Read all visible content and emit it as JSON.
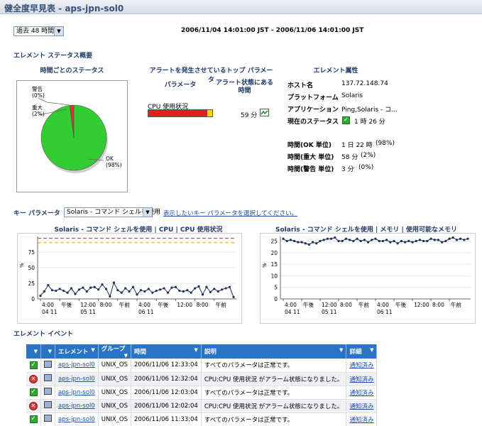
{
  "title": "健全度早見表 - aps-jpn-sol0",
  "time_range": {
    "select": "過去 48 時間",
    "span": "2006/11/04 14:01:00 JST - 2006/11/06 14:01:00 JST"
  },
  "element_status": {
    "heading": "エレメント ステータス概要",
    "hourly": {
      "heading": "時間ごとのステータス",
      "labels": {
        "warning": "警告",
        "warning_pct": "(0%)",
        "critical": "重大",
        "critical_pct": "(2%)",
        "ok": "OK",
        "ok_pct": "(98%)"
      },
      "slices": [
        {
          "name": "OK",
          "value": 98,
          "color": "#33cc33"
        },
        {
          "name": "重大",
          "value": 2,
          "color": "#e03030"
        },
        {
          "name": "警告",
          "value": 0,
          "color": "#ffd700"
        }
      ]
    },
    "top_params": {
      "heading": "アラートを発生させているトップ パラメータ",
      "col_param": "パラメータ",
      "col_alarm": "アラート状態にある時間",
      "rows": [
        {
          "name": "CPU 使用状況",
          "time": "59 分",
          "red_frac": 0.92
        }
      ]
    },
    "attributes": {
      "heading": "エレメント属性",
      "rows": [
        {
          "label": "ホスト名",
          "value": "137.72.148.74"
        },
        {
          "label": "プラットフォーム",
          "value": "Solaris"
        },
        {
          "label": "アプリケーション",
          "value": "Ping,Solaris - コ..."
        },
        {
          "label": "現在のステータス",
          "value": "1 時 26 分"
        }
      ],
      "durations": [
        {
          "label": "時間(OK 単位)",
          "value": "1 日 22 時",
          "pct": "(98%)"
        },
        {
          "label": "時間(重大 単位)",
          "value": "58 分",
          "pct": "(2%)"
        },
        {
          "label": "時間(警告 単位)",
          "value": "3 分",
          "pct": "(0%)"
        }
      ]
    }
  },
  "key_params": {
    "label": "キー パラメータ",
    "select": "Solaris - コマンド シェルを使用",
    "link": "表示したいキー パラメータを選択してください。"
  },
  "chart_data": [
    {
      "type": "line",
      "title": "Solaris - コマンド シェルを使用 | CPU | CPU 使用状況",
      "ylabel": "%",
      "ylim": [
        0,
        100
      ],
      "yticks": [
        "0",
        "25",
        "50",
        "75"
      ],
      "thresholds": [
        {
          "value": 97,
          "color": "#e05050"
        },
        {
          "value": 90,
          "color": "#f0b000"
        }
      ],
      "xticks": [
        {
          "top": "4:00",
          "bottom": "04 11"
        },
        {
          "top": "午後",
          "bottom": ""
        },
        {
          "top": "12:00",
          "bottom": "05 11"
        },
        {
          "top": "8:00",
          "bottom": ""
        },
        {
          "top": "午前",
          "bottom": ""
        },
        {
          "top": "4:00",
          "bottom": "06 11"
        },
        {
          "top": "午後",
          "bottom": ""
        },
        {
          "top": "12:00",
          "bottom": ""
        },
        {
          "top": "8:00",
          "bottom": ""
        },
        {
          "top": "午前",
          "bottom": ""
        }
      ],
      "values": [
        5,
        12,
        22,
        14,
        13,
        16,
        13,
        10,
        17,
        8,
        15,
        18,
        12,
        18,
        19,
        15,
        23,
        16,
        4,
        26,
        14,
        10,
        17,
        12,
        19,
        7,
        14,
        12,
        16,
        10,
        13,
        15,
        17,
        10,
        18,
        19,
        13,
        12,
        14,
        10,
        17,
        20,
        7,
        19,
        11,
        16,
        12,
        15,
        17,
        19,
        3
      ]
    },
    {
      "type": "line",
      "title": "Solaris - コマンド シェルを使用 | メモリ | 使用可能なメモリ",
      "ylabel": "%",
      "ylim": [
        0,
        27
      ],
      "yticks": [
        "0",
        "5",
        "10",
        "15",
        "20",
        "25"
      ],
      "xticks": [
        {
          "top": "4:00",
          "bottom": "04 11"
        },
        {
          "top": "午後",
          "bottom": ""
        },
        {
          "top": "12:00",
          "bottom": "05 11"
        },
        {
          "top": "8:00",
          "bottom": ""
        },
        {
          "top": "午前",
          "bottom": ""
        },
        {
          "top": "4:00",
          "bottom": "06 11"
        },
        {
          "top": "午後",
          "bottom": ""
        },
        {
          "top": "12:00",
          "bottom": ""
        },
        {
          "top": "8:00",
          "bottom": ""
        },
        {
          "top": "午前",
          "bottom": ""
        }
      ],
      "values": [
        26,
        25,
        25.5,
        25,
        24.5,
        24.5,
        24,
        23.5,
        24.5,
        24,
        25,
        25.5,
        26,
        26,
        26.5,
        25,
        25,
        26,
        25.5,
        25,
        26,
        25,
        25.5,
        24.5,
        25.5,
        26,
        25,
        25,
        25.5,
        24.5,
        25,
        24,
        25,
        24.5,
        25,
        24.5,
        25,
        25.5,
        25,
        25,
        26,
        25.5,
        25.5,
        24.5,
        25,
        26,
        26.5,
        25.5,
        26,
        25.5,
        26
      ]
    }
  ],
  "events": {
    "heading": "エレメント イベント",
    "columns": [
      "",
      "",
      "エレメント",
      "グループ",
      "時間",
      "説明",
      "詳細"
    ],
    "rows": [
      {
        "status": "ok",
        "element": "aps-jpn-sol0",
        "group": "UNIX_OS",
        "time": "2006/11/06 12:33:04",
        "desc": "すべてのパラメータは正常です。",
        "detail": "通知済み"
      },
      {
        "status": "critical",
        "element": "aps-jpn-sol0",
        "group": "UNIX_OS",
        "time": "2006/11/06 12:32:04",
        "desc": "CPU:CPU 使用状況 がアラーム状態になりました。",
        "detail": "通知済み"
      },
      {
        "status": "ok",
        "element": "aps-jpn-sol0",
        "group": "UNIX_OS",
        "time": "2006/11/06 12:03:04",
        "desc": "すべてのパラメータは正常です。",
        "detail": "通知済み"
      },
      {
        "status": "critical",
        "element": "aps-jpn-sol0",
        "group": "UNIX_OS",
        "time": "2006/11/06 12:02:04",
        "desc": "CPU:CPU 使用状況 がアラーム状態になりました。",
        "detail": "通知済み"
      },
      {
        "status": "ok",
        "element": "aps-jpn-sol0",
        "group": "UNIX_OS",
        "time": "2006/11/06 11:33:04",
        "desc": "すべてのパラメータは正常です。",
        "detail": "通知済み"
      }
    ]
  }
}
